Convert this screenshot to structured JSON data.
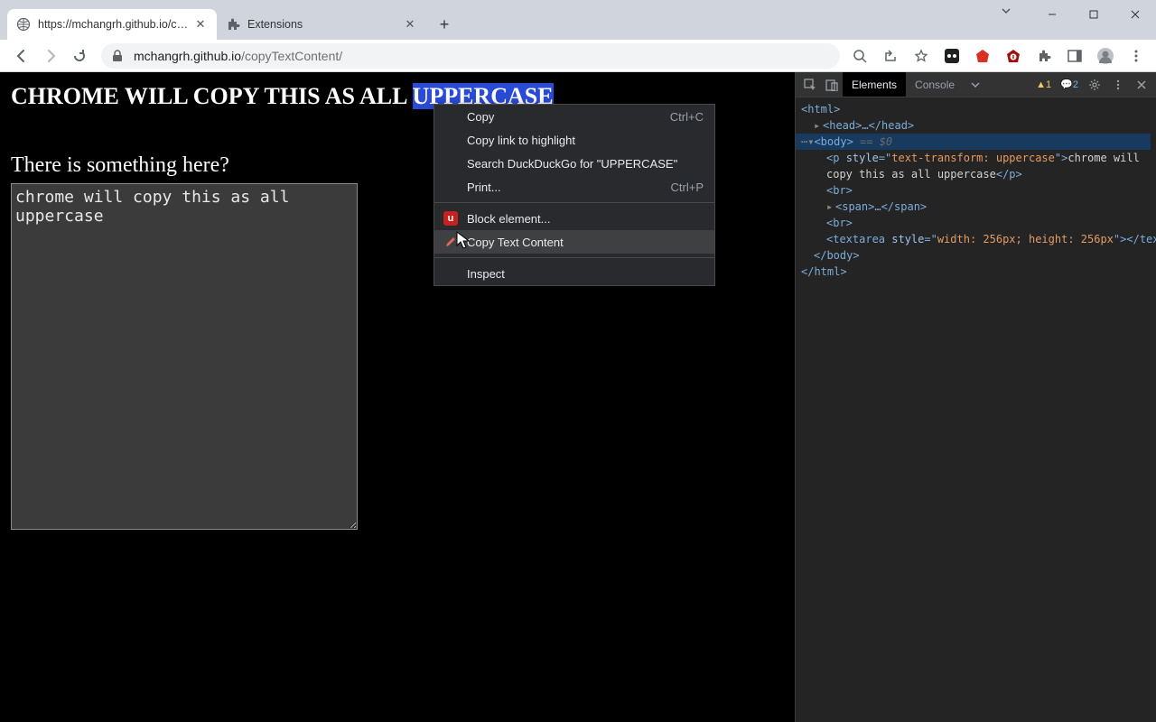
{
  "tabs": [
    {
      "title": "https://mchangrh.github.io/copy",
      "active": true
    },
    {
      "title": "Extensions",
      "active": false
    }
  ],
  "url": {
    "domain": "mchangrh.github.io",
    "path": "/copyTextContent/"
  },
  "page": {
    "heading_prefix": "chrome will copy this as all ",
    "heading_selected": "uppercase",
    "subheading": "There is something here?",
    "textarea_value": "chrome will copy this as all uppercase"
  },
  "context_menu": {
    "items": [
      {
        "label": "Copy",
        "shortcut": "Ctrl+C"
      },
      {
        "label": "Copy link to highlight"
      },
      {
        "label": "Search DuckDuckGo for \"UPPERCASE\""
      },
      {
        "label": "Print...",
        "shortcut": "Ctrl+P"
      },
      {
        "sep": true
      },
      {
        "label": "Block element...",
        "icon": "ublock"
      },
      {
        "label": "Copy Text Content",
        "icon": "pencil",
        "hovered": true
      },
      {
        "sep": true
      },
      {
        "label": "Inspect"
      }
    ]
  },
  "devtools": {
    "tabs": {
      "elements": "Elements",
      "console": "Console"
    },
    "warnings": "1",
    "infos": "2",
    "dom": {
      "html_open": "<html>",
      "head": "<head>…</head>",
      "body_open": "<body>",
      "body_hint": " == $0",
      "p_open": "<p ",
      "p_attr_name": "style",
      "p_attr_eq": "=\"",
      "p_attr_val": "text-transform: uppercase",
      "p_attr_close": "\">",
      "p_text": "chrome will copy this as all uppercase",
      "p_close": "</p>",
      "br": "<br>",
      "span": "<span>…</span>",
      "textarea_open": "<textarea ",
      "textarea_attr_name": "style",
      "textarea_attr_val": "width: 256px; height: 256px",
      "textarea_close": "></textarea>",
      "body_close": "</body>",
      "html_close": "</html>"
    }
  }
}
